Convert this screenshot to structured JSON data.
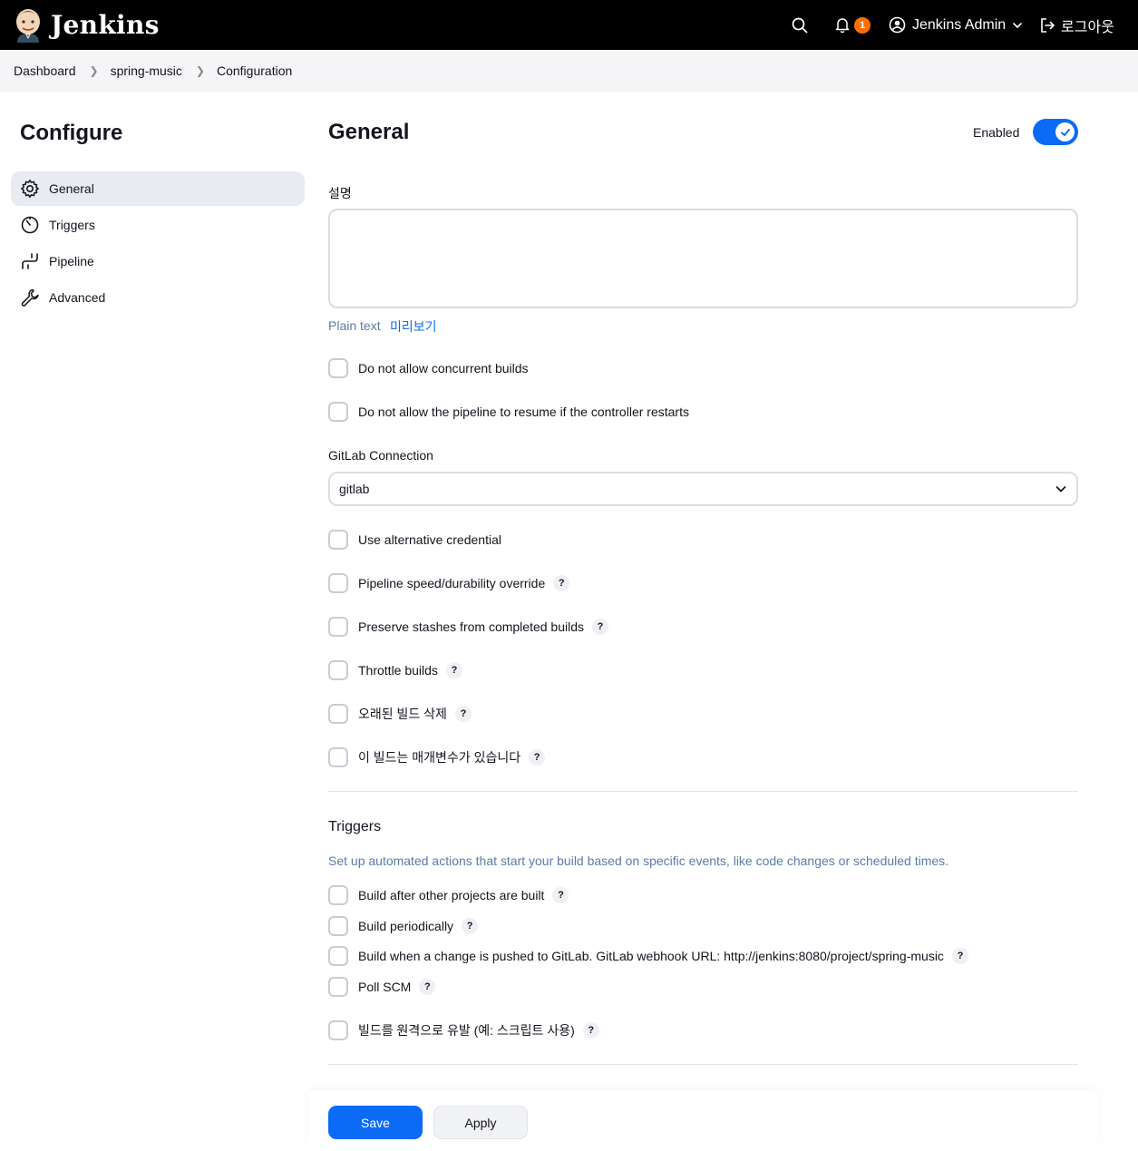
{
  "header": {
    "logo_text": "Jenkins",
    "notification_count": "1",
    "user_name": "Jenkins Admin",
    "logout_label": "로그아웃"
  },
  "breadcrumb": [
    "Dashboard",
    "spring-music",
    "Configuration"
  ],
  "sidebar": {
    "title": "Configure",
    "items": [
      {
        "label": "General",
        "icon": "gear-icon",
        "active": true
      },
      {
        "label": "Triggers",
        "icon": "timer-icon",
        "active": false
      },
      {
        "label": "Pipeline",
        "icon": "pipeline-icon",
        "active": false
      },
      {
        "label": "Advanced",
        "icon": "wrench-icon",
        "active": false
      }
    ]
  },
  "general": {
    "title": "General",
    "enabled_label": "Enabled",
    "enabled": true,
    "description_label": "설명",
    "description_value": "",
    "plain_text": "Plain text",
    "preview_link": "미리보기",
    "checkboxes": [
      {
        "label": "Do not allow concurrent builds",
        "checked": false,
        "help": false
      },
      {
        "label": "Do not allow the pipeline to resume if the controller restarts",
        "checked": false,
        "help": false
      }
    ],
    "gitlab_connection_label": "GitLab Connection",
    "gitlab_connection_value": "gitlab",
    "more_checkboxes": [
      {
        "label": "Use alternative credential",
        "checked": false,
        "help": false
      },
      {
        "label": "Pipeline speed/durability override",
        "checked": false,
        "help": true
      },
      {
        "label": "Preserve stashes from completed builds",
        "checked": false,
        "help": true
      },
      {
        "label": "Throttle builds",
        "checked": false,
        "help": true
      },
      {
        "label": "오래된 빌드 삭제",
        "checked": false,
        "help": true
      },
      {
        "label": "이 빌드는 매개변수가 있습니다",
        "checked": false,
        "help": true
      }
    ]
  },
  "triggers": {
    "title": "Triggers",
    "description": "Set up automated actions that start your build based on specific events, like code changes or scheduled times.",
    "checkboxes": [
      {
        "label": "Build after other projects are built",
        "checked": false,
        "help": true
      },
      {
        "label": "Build periodically",
        "checked": false,
        "help": true
      },
      {
        "label": "Build when a change is pushed to GitLab. GitLab webhook URL: http://jenkins:8080/project/spring-music",
        "checked": false,
        "help": true
      },
      {
        "label": "Poll SCM",
        "checked": false,
        "help": true
      },
      {
        "label": "빌드를 원격으로 유발 (예: 스크립트 사용)",
        "checked": false,
        "help": true
      }
    ]
  },
  "help_glyph": "?",
  "actions": {
    "save_label": "Save",
    "apply_label": "Apply"
  },
  "colors": {
    "accent": "#0b6bf5",
    "header_bg": "#000000",
    "badge": "#fe6e00"
  }
}
